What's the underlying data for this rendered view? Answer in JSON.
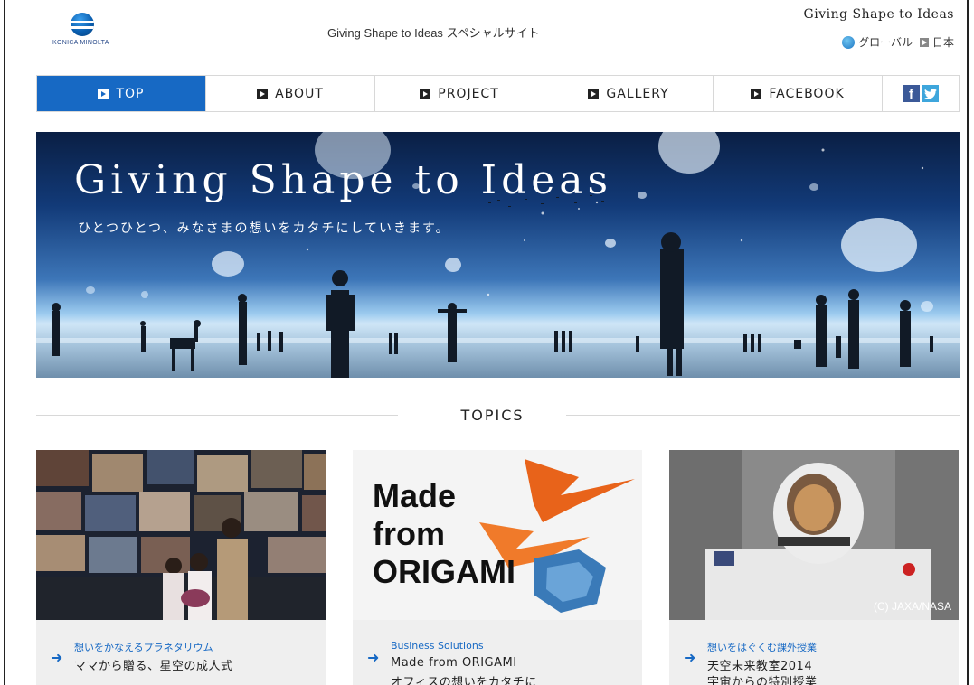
{
  "header": {
    "tagline": "Giving Shape to Ideas",
    "logo_text": "KONICA MINOLTA",
    "site_title": "Giving Shape to Ideas スペシャルサイト",
    "lang_global": "グローバル",
    "lang_japan": "日本"
  },
  "nav": {
    "items": [
      {
        "label": "TOP",
        "active": true
      },
      {
        "label": "ABOUT",
        "active": false
      },
      {
        "label": "PROJECT",
        "active": false
      },
      {
        "label": "GALLERY",
        "active": false
      },
      {
        "label": "FACEBOOK",
        "active": false
      }
    ],
    "social": {
      "facebook": "f",
      "twitter": "t"
    }
  },
  "hero": {
    "title": "Giving Shape to Ideas",
    "subtitle": "ひとつひとつ、みなさまの想いをカタチにしていきます。"
  },
  "topics": {
    "title": "TOPICS",
    "cards": [
      {
        "image": "planetarium-wedding-photo",
        "subtitle": "想いをかなえるプラネタリウム",
        "heading": "ママから贈る、星空の成人式",
        "heading2": ""
      },
      {
        "image": "origami-cranes-photo",
        "image_text": [
          "Made",
          "from",
          "ORIGAMI"
        ],
        "subtitle": "Business Solutions",
        "heading": "Made from ORIGAMI",
        "heading2": "オフィスの想いをカタチに"
      },
      {
        "image": "astronaut-photo",
        "image_credit": "(C) JAXA/NASA",
        "subtitle": "想いをはぐくむ課外授業",
        "heading": "天空未来教室2014",
        "heading2": "宇宙からの特別授業"
      }
    ]
  },
  "colors": {
    "accent": "#1769c4",
    "card_bg": "#efefef"
  }
}
